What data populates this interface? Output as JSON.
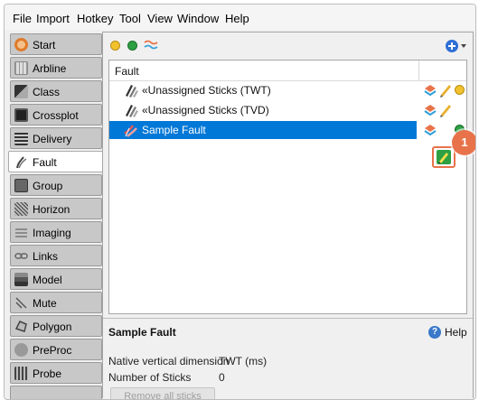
{
  "menu": [
    "File",
    "Import",
    "Hotkey",
    "Tool",
    "View",
    "Window",
    "Help"
  ],
  "sidebar": {
    "items": [
      {
        "label": "Start",
        "icon": "start-icon",
        "color": "#e07b2a"
      },
      {
        "label": "Arbline",
        "icon": "arbline-icon",
        "color": "#888888"
      },
      {
        "label": "Class",
        "icon": "class-icon",
        "color": "#555555"
      },
      {
        "label": "Crossplot",
        "icon": "crossplot-icon",
        "color": "#333333"
      },
      {
        "label": "Delivery",
        "icon": "delivery-icon",
        "color": "#444444"
      },
      {
        "label": "Fault",
        "icon": "fault-icon",
        "color": "#555555",
        "active": true
      },
      {
        "label": "Group",
        "icon": "group-icon",
        "color": "#666666"
      },
      {
        "label": "Horizon",
        "icon": "horizon-icon",
        "color": "#555555"
      },
      {
        "label": "Imaging",
        "icon": "imaging-icon",
        "color": "#777777"
      },
      {
        "label": "Links",
        "icon": "links-icon",
        "color": "#666666"
      },
      {
        "label": "Model",
        "icon": "model-icon",
        "color": "#555555"
      },
      {
        "label": "Mute",
        "icon": "mute-icon",
        "color": "#666666"
      },
      {
        "label": "Polygon",
        "icon": "polygon-icon",
        "color": "#555555"
      },
      {
        "label": "PreProc",
        "icon": "preproc-icon",
        "color": "#666666"
      },
      {
        "label": "Probe",
        "icon": "probe-icon",
        "color": "#555555"
      }
    ]
  },
  "toolbar": {
    "dots": [
      {
        "name": "yellow-status-icon",
        "color": "#f2c12e"
      },
      {
        "name": "green-status-icon",
        "color": "#2ea043"
      }
    ],
    "wave_icon": "horizon-wave-icon",
    "add_icon": "add-circle-icon"
  },
  "tree": {
    "header": "Fault",
    "rows": [
      {
        "label": "«Unassigned Sticks (TWT)",
        "selected": false
      },
      {
        "label": "«Unassigned Sticks (TVD)",
        "selected": false
      },
      {
        "label": "Sample Fault",
        "selected": true
      }
    ]
  },
  "callout": {
    "number": "1"
  },
  "details": {
    "title": "Sample Fault",
    "help": "Help",
    "properties": [
      {
        "label": "Native vertical dimension",
        "value": "TWT (ms)"
      },
      {
        "label": "Number of Sticks",
        "value": "0"
      }
    ],
    "remove_button": "Remove all sticks"
  }
}
